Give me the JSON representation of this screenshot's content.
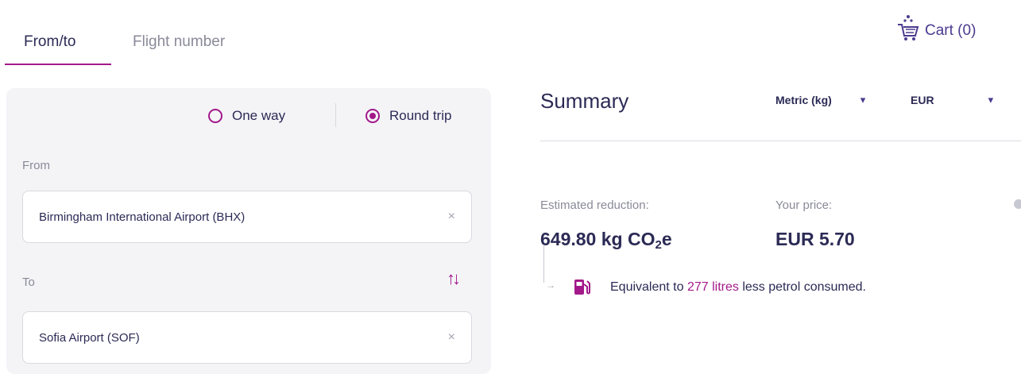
{
  "tabs": [
    {
      "label": "From/to",
      "active": true
    },
    {
      "label": "Flight number",
      "active": false
    }
  ],
  "cart": {
    "label": "Cart (0)",
    "icon": "cart-icon"
  },
  "trip_type": {
    "one_way": "One way",
    "round_trip": "Round trip",
    "selected": "Round trip"
  },
  "from": {
    "label": "From",
    "value": "Birmingham International Airport (BHX)",
    "clear": "×"
  },
  "to": {
    "label": "To",
    "value": "Sofia Airport (SOF)",
    "clear": "×",
    "swap_icon": "swap-icon"
  },
  "summary": {
    "title": "Summary",
    "units_select": "Metric (kg)",
    "currency_select": "EUR",
    "reduction_label": "Estimated reduction:",
    "reduction_value": "649.80 kg CO",
    "reduction_sub": "2",
    "reduction_suffix": "e",
    "price_label": "Your price:",
    "price_value": "EUR 5.70",
    "equiv_prefix": "Equivalent to ",
    "equiv_amount": "277 litres",
    "equiv_suffix": " less petrol consumed."
  },
  "colors": {
    "accent": "#a3198a",
    "text": "#2b2a55",
    "muted": "#8a8a99",
    "panel": "#f4f4f7"
  }
}
